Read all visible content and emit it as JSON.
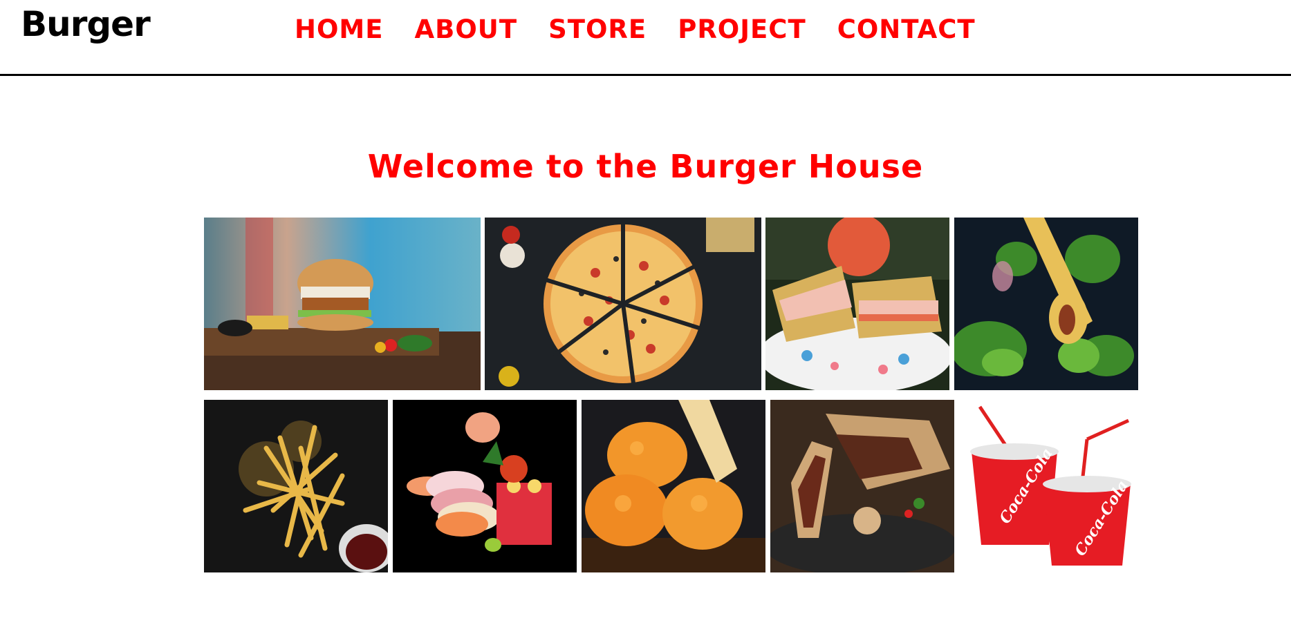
{
  "header": {
    "logo": "Burger",
    "nav": [
      {
        "label": "HOME"
      },
      {
        "label": "ABOUT"
      },
      {
        "label": "STORE"
      },
      {
        "label": "PROJECT"
      },
      {
        "label": "CONTACT"
      }
    ]
  },
  "main": {
    "title": "Welcome to the Burger House",
    "gallery": [
      {
        "name": "burger-photo"
      },
      {
        "name": "pizza-photo"
      },
      {
        "name": "sandwich-photo"
      },
      {
        "name": "roll-photo"
      },
      {
        "name": "fries-photo"
      },
      {
        "name": "sushi-photo"
      },
      {
        "name": "nuggets-photo"
      },
      {
        "name": "wrap-photo"
      },
      {
        "name": "soda-cups-photo",
        "brand_text": "Coca-Cola"
      }
    ]
  },
  "colors": {
    "accent": "#ff0000",
    "text": "#000000",
    "background": "#ffffff"
  }
}
